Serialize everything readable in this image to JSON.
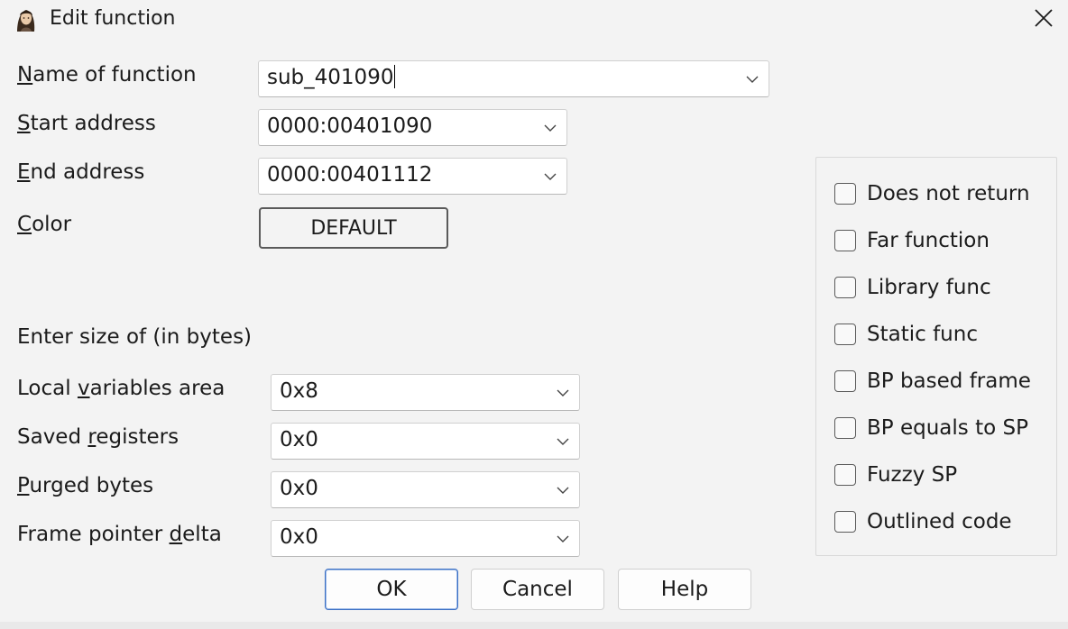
{
  "window": {
    "title": "Edit function",
    "app_icon": "ida-portrait-icon",
    "close_icon": "close-icon"
  },
  "fields": {
    "name": {
      "label_pre": "",
      "label_u": "N",
      "label_post": "ame of function",
      "value": "sub_401090"
    },
    "start": {
      "label_pre": "",
      "label_u": "S",
      "label_post": "tart address",
      "value": "0000:00401090"
    },
    "end": {
      "label_pre": "",
      "label_u": "E",
      "label_post": "nd address",
      "value": "0000:00401112"
    },
    "color": {
      "label_pre": "",
      "label_u": "C",
      "label_post": "olor",
      "button": "DEFAULT"
    }
  },
  "sizes": {
    "heading": "Enter size of (in bytes)",
    "local": {
      "label_pre": "Local ",
      "label_u": "v",
      "label_post": "ariables area",
      "value": "0x8"
    },
    "saved": {
      "label_pre": "Saved ",
      "label_u": "r",
      "label_post": "egisters",
      "value": "0x0"
    },
    "purged": {
      "label_pre": "",
      "label_u": "P",
      "label_post": "urged bytes",
      "value": "0x0"
    },
    "fpd": {
      "label_pre": "Frame pointer ",
      "label_u": "d",
      "label_post": "elta",
      "value": "0x0"
    }
  },
  "flags": [
    {
      "label": "Does not return",
      "checked": false
    },
    {
      "label": "Far function",
      "checked": false
    },
    {
      "label": "Library func",
      "checked": false
    },
    {
      "label": "Static func",
      "checked": false
    },
    {
      "label": "BP based frame",
      "checked": false
    },
    {
      "label": "BP equals to SP",
      "checked": false
    },
    {
      "label": "Fuzzy SP",
      "checked": false
    },
    {
      "label": "Outlined code",
      "checked": false
    }
  ],
  "buttons": {
    "ok": "OK",
    "cancel": "Cancel",
    "help": "Help"
  }
}
